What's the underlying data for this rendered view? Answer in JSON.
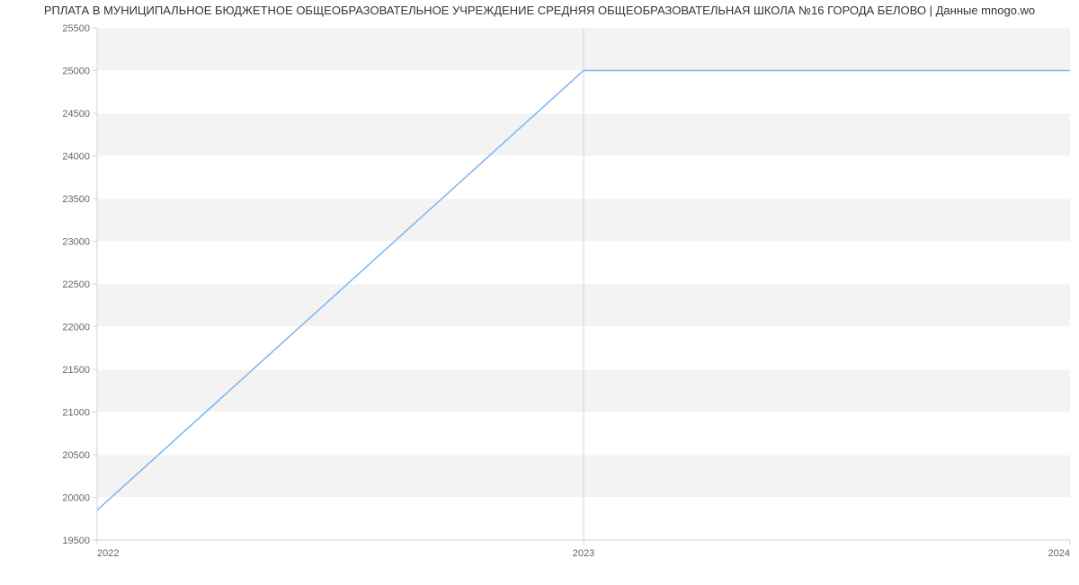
{
  "title": "РПЛАТА В МУНИЦИПАЛЬНОЕ БЮДЖЕТНОЕ ОБЩЕОБРАЗОВАТЕЛЬНОЕ УЧРЕЖДЕНИЕ СРЕДНЯЯ ОБЩЕОБРАЗОВАТЕЛЬНАЯ ШКОЛА №16 ГОРОДА БЕЛОВО | Данные mnogo.wo",
  "chart_data": {
    "type": "line",
    "title": "РПЛАТА В МУНИЦИПАЛЬНОЕ БЮДЖЕТНОЕ ОБЩЕОБРАЗОВАТЕЛЬНОЕ УЧРЕЖДЕНИЕ СРЕДНЯЯ ОБЩЕОБРАЗОВАТЕЛЬНАЯ ШКОЛА №16 ГОРОДА БЕЛОВО | Данные mnogo.wo",
    "x": [
      2022,
      2023,
      2024
    ],
    "values": [
      19850,
      25000,
      25000
    ],
    "xlabel": "",
    "ylabel": "",
    "x_ticks": [
      "2022",
      "2023",
      "2024"
    ],
    "y_ticks": [
      "19500",
      "20000",
      "20500",
      "21000",
      "21500",
      "22000",
      "22500",
      "23000",
      "23500",
      "24000",
      "24500",
      "25000",
      "25500"
    ],
    "ylim": [
      19500,
      25500
    ],
    "xlim": [
      2022,
      2024
    ]
  }
}
